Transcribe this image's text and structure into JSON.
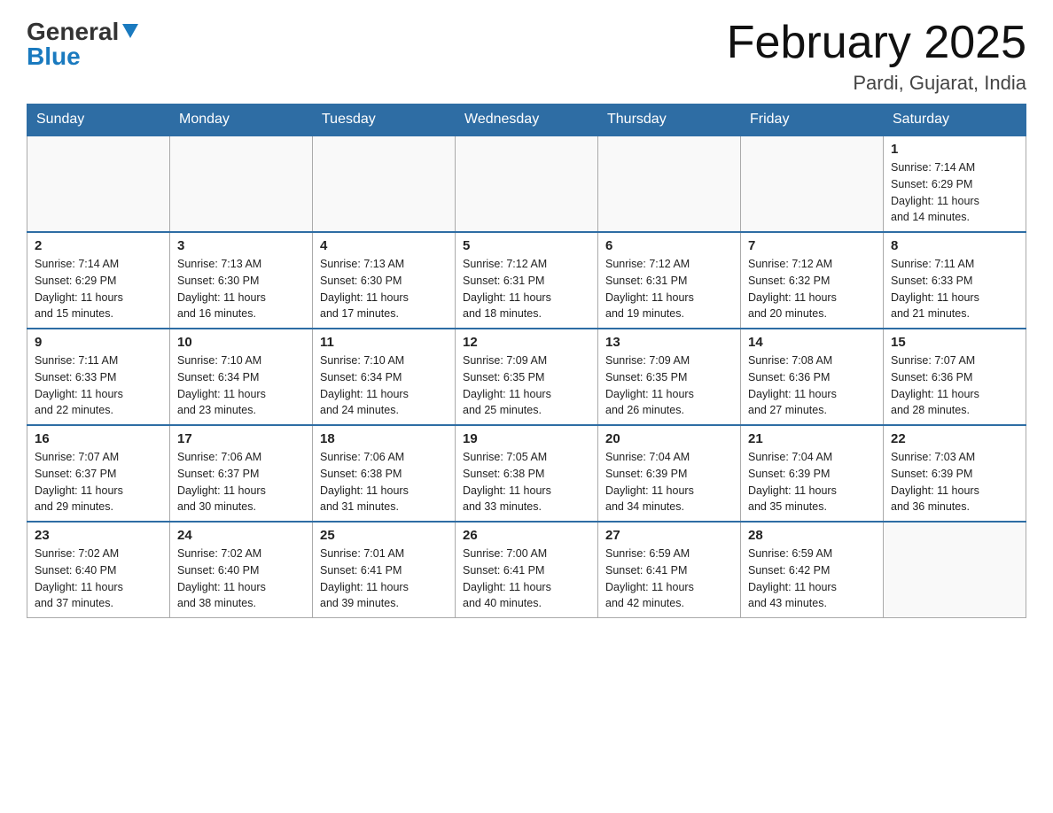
{
  "header": {
    "logo_general": "General",
    "logo_blue": "Blue",
    "title": "February 2025",
    "subtitle": "Pardi, Gujarat, India"
  },
  "days_of_week": [
    "Sunday",
    "Monday",
    "Tuesday",
    "Wednesday",
    "Thursday",
    "Friday",
    "Saturday"
  ],
  "weeks": [
    {
      "days": [
        {
          "number": "",
          "info": "",
          "empty": true
        },
        {
          "number": "",
          "info": "",
          "empty": true
        },
        {
          "number": "",
          "info": "",
          "empty": true
        },
        {
          "number": "",
          "info": "",
          "empty": true
        },
        {
          "number": "",
          "info": "",
          "empty": true
        },
        {
          "number": "",
          "info": "",
          "empty": true
        },
        {
          "number": "1",
          "info": "Sunrise: 7:14 AM\nSunset: 6:29 PM\nDaylight: 11 hours\nand 14 minutes.",
          "empty": false
        }
      ]
    },
    {
      "days": [
        {
          "number": "2",
          "info": "Sunrise: 7:14 AM\nSunset: 6:29 PM\nDaylight: 11 hours\nand 15 minutes.",
          "empty": false
        },
        {
          "number": "3",
          "info": "Sunrise: 7:13 AM\nSunset: 6:30 PM\nDaylight: 11 hours\nand 16 minutes.",
          "empty": false
        },
        {
          "number": "4",
          "info": "Sunrise: 7:13 AM\nSunset: 6:30 PM\nDaylight: 11 hours\nand 17 minutes.",
          "empty": false
        },
        {
          "number": "5",
          "info": "Sunrise: 7:12 AM\nSunset: 6:31 PM\nDaylight: 11 hours\nand 18 minutes.",
          "empty": false
        },
        {
          "number": "6",
          "info": "Sunrise: 7:12 AM\nSunset: 6:31 PM\nDaylight: 11 hours\nand 19 minutes.",
          "empty": false
        },
        {
          "number": "7",
          "info": "Sunrise: 7:12 AM\nSunset: 6:32 PM\nDaylight: 11 hours\nand 20 minutes.",
          "empty": false
        },
        {
          "number": "8",
          "info": "Sunrise: 7:11 AM\nSunset: 6:33 PM\nDaylight: 11 hours\nand 21 minutes.",
          "empty": false
        }
      ]
    },
    {
      "days": [
        {
          "number": "9",
          "info": "Sunrise: 7:11 AM\nSunset: 6:33 PM\nDaylight: 11 hours\nand 22 minutes.",
          "empty": false
        },
        {
          "number": "10",
          "info": "Sunrise: 7:10 AM\nSunset: 6:34 PM\nDaylight: 11 hours\nand 23 minutes.",
          "empty": false
        },
        {
          "number": "11",
          "info": "Sunrise: 7:10 AM\nSunset: 6:34 PM\nDaylight: 11 hours\nand 24 minutes.",
          "empty": false
        },
        {
          "number": "12",
          "info": "Sunrise: 7:09 AM\nSunset: 6:35 PM\nDaylight: 11 hours\nand 25 minutes.",
          "empty": false
        },
        {
          "number": "13",
          "info": "Sunrise: 7:09 AM\nSunset: 6:35 PM\nDaylight: 11 hours\nand 26 minutes.",
          "empty": false
        },
        {
          "number": "14",
          "info": "Sunrise: 7:08 AM\nSunset: 6:36 PM\nDaylight: 11 hours\nand 27 minutes.",
          "empty": false
        },
        {
          "number": "15",
          "info": "Sunrise: 7:07 AM\nSunset: 6:36 PM\nDaylight: 11 hours\nand 28 minutes.",
          "empty": false
        }
      ]
    },
    {
      "days": [
        {
          "number": "16",
          "info": "Sunrise: 7:07 AM\nSunset: 6:37 PM\nDaylight: 11 hours\nand 29 minutes.",
          "empty": false
        },
        {
          "number": "17",
          "info": "Sunrise: 7:06 AM\nSunset: 6:37 PM\nDaylight: 11 hours\nand 30 minutes.",
          "empty": false
        },
        {
          "number": "18",
          "info": "Sunrise: 7:06 AM\nSunset: 6:38 PM\nDaylight: 11 hours\nand 31 minutes.",
          "empty": false
        },
        {
          "number": "19",
          "info": "Sunrise: 7:05 AM\nSunset: 6:38 PM\nDaylight: 11 hours\nand 33 minutes.",
          "empty": false
        },
        {
          "number": "20",
          "info": "Sunrise: 7:04 AM\nSunset: 6:39 PM\nDaylight: 11 hours\nand 34 minutes.",
          "empty": false
        },
        {
          "number": "21",
          "info": "Sunrise: 7:04 AM\nSunset: 6:39 PM\nDaylight: 11 hours\nand 35 minutes.",
          "empty": false
        },
        {
          "number": "22",
          "info": "Sunrise: 7:03 AM\nSunset: 6:39 PM\nDaylight: 11 hours\nand 36 minutes.",
          "empty": false
        }
      ]
    },
    {
      "days": [
        {
          "number": "23",
          "info": "Sunrise: 7:02 AM\nSunset: 6:40 PM\nDaylight: 11 hours\nand 37 minutes.",
          "empty": false
        },
        {
          "number": "24",
          "info": "Sunrise: 7:02 AM\nSunset: 6:40 PM\nDaylight: 11 hours\nand 38 minutes.",
          "empty": false
        },
        {
          "number": "25",
          "info": "Sunrise: 7:01 AM\nSunset: 6:41 PM\nDaylight: 11 hours\nand 39 minutes.",
          "empty": false
        },
        {
          "number": "26",
          "info": "Sunrise: 7:00 AM\nSunset: 6:41 PM\nDaylight: 11 hours\nand 40 minutes.",
          "empty": false
        },
        {
          "number": "27",
          "info": "Sunrise: 6:59 AM\nSunset: 6:41 PM\nDaylight: 11 hours\nand 42 minutes.",
          "empty": false
        },
        {
          "number": "28",
          "info": "Sunrise: 6:59 AM\nSunset: 6:42 PM\nDaylight: 11 hours\nand 43 minutes.",
          "empty": false
        },
        {
          "number": "",
          "info": "",
          "empty": true
        }
      ]
    }
  ]
}
